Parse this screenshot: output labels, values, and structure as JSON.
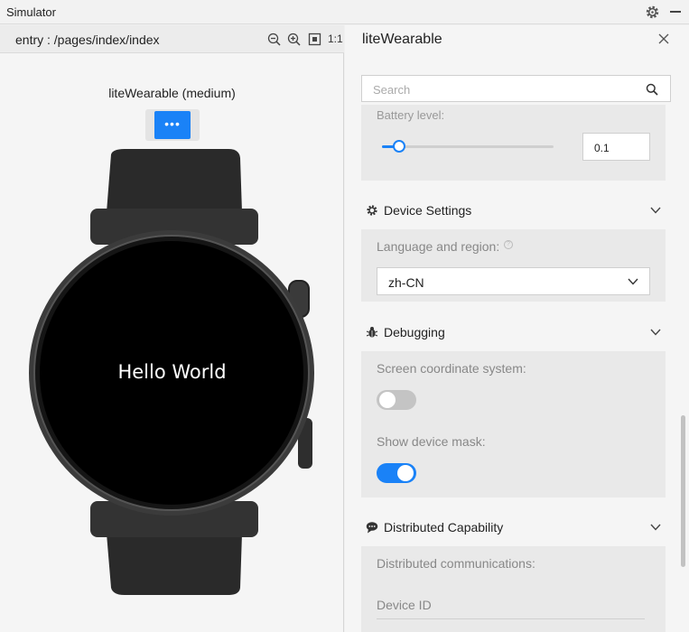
{
  "window": {
    "title": "Simulator"
  },
  "left": {
    "route": "entry : /pages/index/index",
    "actual_size": "1:1",
    "device_label": "liteWearable (medium)",
    "more_label": "•••",
    "screen_text": "Hello World"
  },
  "right": {
    "title": "liteWearable",
    "search": {
      "placeholder": "Search"
    },
    "battery": {
      "label": "Battery level:",
      "value": "0.1",
      "level": 0.1
    },
    "device_settings": {
      "title": "Device Settings",
      "language_label": "Language and region:",
      "language_value": "zh-CN"
    },
    "debugging": {
      "title": "Debugging",
      "coordinate_label": "Screen coordinate system:",
      "coordinate_on": false,
      "mask_label": "Show device mask:",
      "mask_on": true
    },
    "distributed": {
      "title": "Distributed Capability",
      "communications_label": "Distributed communications:",
      "device_id_label": "Device ID"
    }
  },
  "colors": {
    "accent": "#1a82f7",
    "panel": "#e9e9e9"
  }
}
